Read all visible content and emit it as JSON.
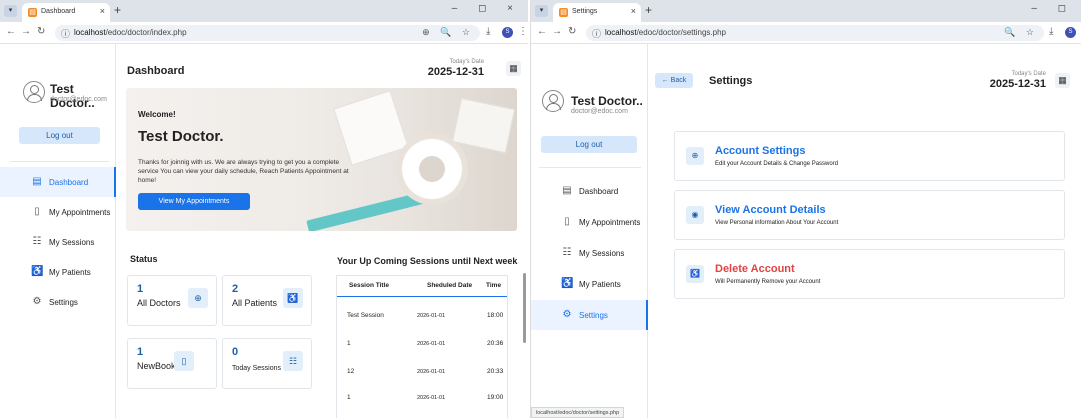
{
  "left": {
    "tab": {
      "title": "Dashboard",
      "close": "×"
    },
    "new_tab": "+",
    "window_controls": "– ◻ ×",
    "url": {
      "host": "localhost",
      "path": "/edoc/doctor/index.php"
    },
    "omni_right": "⊕ 🔍 ☆",
    "profile_initial": "S",
    "user": {
      "name": "Test Doctor..",
      "email": "doctor@edoc.com",
      "logout": "Log out"
    },
    "menu": [
      {
        "label": "Dashboard",
        "icon": "dashboard-icon",
        "glyph": "▤"
      },
      {
        "label": "My Appointments",
        "icon": "bookmark-icon",
        "glyph": "▯"
      },
      {
        "label": "My Sessions",
        "icon": "sessions-icon",
        "glyph": "☷"
      },
      {
        "label": "My Patients",
        "icon": "patients-icon",
        "glyph": "♿"
      },
      {
        "label": "Settings",
        "icon": "gear-icon",
        "glyph": "⚙"
      }
    ],
    "page_title": "Dashboard",
    "date_label": "Today's Date",
    "date_value": "2025-12-31",
    "hero": {
      "welcome": "Welcome!",
      "name": "Test Doctor.",
      "text": "Thanks for joinnig with us. We are always trying to get you a complete service You can view your daily schedule, Reach Patients Appointment at home!",
      "button": "View My Appointments"
    },
    "status_title": "Status",
    "stats": [
      {
        "value": "1",
        "label": "All Doctors",
        "icon": "doctor-icon",
        "glyph": "⊕"
      },
      {
        "value": "2",
        "label": "All Patients",
        "icon": "patients-icon",
        "glyph": "♿"
      },
      {
        "value": "1",
        "label": "NewBooking",
        "icon": "bookmark-icon",
        "glyph": "▯"
      },
      {
        "value": "0",
        "label": "Today Sessions",
        "icon": "sessions-icon",
        "glyph": "☷"
      }
    ],
    "sessions_title": "Your Up Coming Sessions until Next week",
    "table": {
      "headers": [
        "Session Title",
        "Sheduled Date",
        "Time"
      ],
      "rows": [
        [
          "Test Session",
          "2026-01-01",
          "18:00"
        ],
        [
          "1",
          "2026-01-01",
          "20:36"
        ],
        [
          "12",
          "2026-01-01",
          "20:33"
        ],
        [
          "1",
          "2026-01-01",
          "19:00"
        ]
      ]
    }
  },
  "right": {
    "tab": {
      "title": "Settings",
      "close": "×"
    },
    "new_tab": "+",
    "window_controls": "– ◻",
    "url": {
      "host": "localhost",
      "path": "/edoc/doctor/settings.php"
    },
    "omni_right": "🔍 ☆",
    "profile_initial": "S",
    "user": {
      "name": "Test Doctor..",
      "email": "doctor@edoc.com",
      "logout": "Log out"
    },
    "menu": [
      {
        "label": "Dashboard",
        "icon": "dashboard-icon",
        "glyph": "▤"
      },
      {
        "label": "My Appointments",
        "icon": "bookmark-icon",
        "glyph": "▯"
      },
      {
        "label": "My Sessions",
        "icon": "sessions-icon",
        "glyph": "☷"
      },
      {
        "label": "My Patients",
        "icon": "patients-icon",
        "glyph": "♿"
      },
      {
        "label": "Settings",
        "icon": "gear-icon",
        "glyph": "⚙"
      }
    ],
    "back": "← Back",
    "page_title": "Settings",
    "date_label": "Today's Date",
    "date_value": "2025-12-31",
    "cards": [
      {
        "title": "Account Settings",
        "desc": "Edit your Account Details & Change Password",
        "icon": "account-settings-icon",
        "glyph": "⊕"
      },
      {
        "title": "View Account Details",
        "desc": "View Personal information About Your Account",
        "icon": "eye-icon",
        "glyph": "◉"
      },
      {
        "title": "Delete Account",
        "desc": "Will Permanently Remove your Account",
        "icon": "delete-account-icon",
        "glyph": "♿"
      }
    ],
    "status_url": "localhost/edoc/doctor/settings.php"
  },
  "colors": {
    "accent": "#1a73e8",
    "accent_light": "#d6e7fb",
    "danger": "#e04343"
  }
}
